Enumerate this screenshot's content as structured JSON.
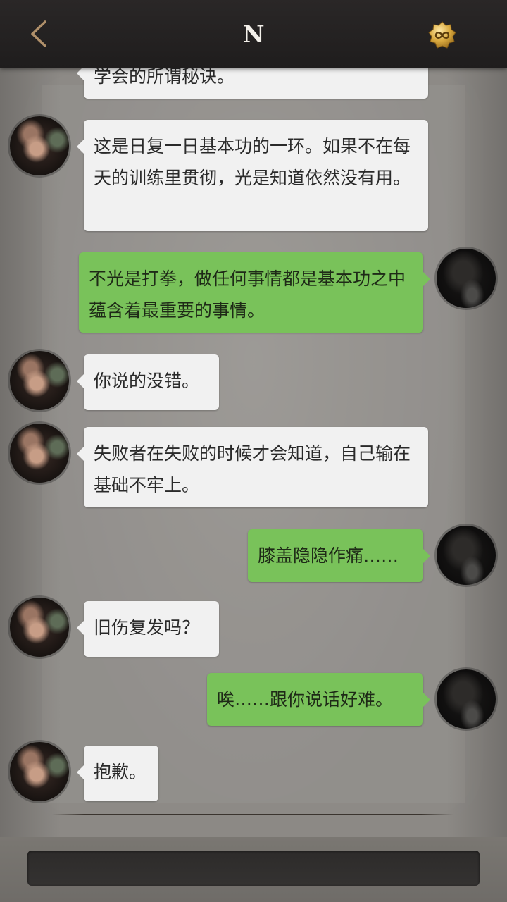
{
  "header": {
    "title": "N",
    "back_icon": "chevron-left-icon",
    "badge_icon": "infinity-gold-badge-icon",
    "accent_color": "#c9a24a"
  },
  "messages": [
    {
      "side": "left",
      "text": "学会的所谓秘诀。"
    },
    {
      "side": "left",
      "text": "这是日复一日基本功的一环。如果不在每天的训练里贯彻，光是知道依然没有用。"
    },
    {
      "side": "right",
      "text": "不光是打拳，做任何事情都是基本功之中蕴含着最重要的事情。"
    },
    {
      "side": "left",
      "text": "你说的没错。"
    },
    {
      "side": "left",
      "text": "失败者在失败的时候才会知道，自己输在基础不牢上。"
    },
    {
      "side": "right",
      "text": "膝盖隐隐作痛……"
    },
    {
      "side": "left",
      "text": "旧伤复发吗？"
    },
    {
      "side": "right",
      "text": "唉……跟你说话好难。"
    },
    {
      "side": "left",
      "text": "抱歉。"
    }
  ],
  "colors": {
    "incoming_bubble": "#f1f1f1",
    "outgoing_bubble": "#79c25a",
    "header_bg": "#242121"
  }
}
